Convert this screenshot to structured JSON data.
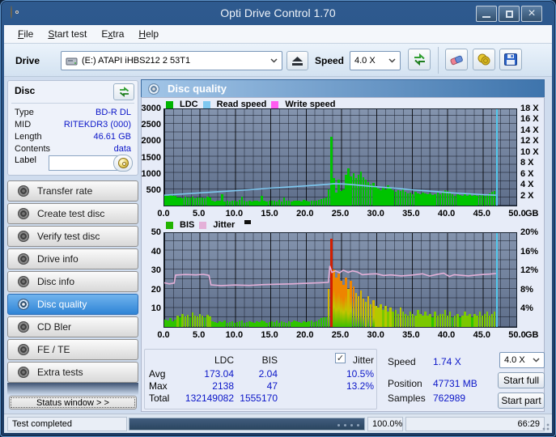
{
  "window": {
    "title": "Opti Drive Control 1.70"
  },
  "menu": {
    "items": [
      {
        "label": "File",
        "underline": 0
      },
      {
        "label": "Start test",
        "underline": 0
      },
      {
        "label": "Extra",
        "underline": 1
      },
      {
        "label": "Help",
        "underline": 0
      }
    ]
  },
  "toolbar": {
    "drive_label": "Drive",
    "drive_value": "(E:)   ATAPI iHBS212   2 53T1",
    "speed_label": "Speed",
    "speed_value": "4.0 X",
    "icons": [
      "drive-icon",
      "eject-icon",
      "refresh-icon",
      "eraser-icon",
      "coins-icon",
      "save-icon"
    ]
  },
  "disc_panel": {
    "title": "Disc",
    "rows": [
      {
        "label": "Type",
        "value": "BD-R DL"
      },
      {
        "label": "MID",
        "value": "RITEKDR3 (000)"
      },
      {
        "label": "Length",
        "value": "46.61 GB"
      },
      {
        "label": "Contents",
        "value": "data"
      }
    ],
    "label_row": {
      "label": "Label",
      "value": ""
    }
  },
  "sidebar": {
    "buttons": [
      {
        "label": "Transfer rate",
        "selected": false
      },
      {
        "label": "Create test disc",
        "selected": false
      },
      {
        "label": "Verify test disc",
        "selected": false
      },
      {
        "label": "Drive info",
        "selected": false
      },
      {
        "label": "Disc info",
        "selected": false
      },
      {
        "label": "Disc quality",
        "selected": true
      },
      {
        "label": "CD Bler",
        "selected": false
      },
      {
        "label": "FE / TE",
        "selected": false
      },
      {
        "label": "Extra tests",
        "selected": false
      }
    ],
    "status_window_label": "Status window > >"
  },
  "quality_header": "Disc quality",
  "chart_data": [
    {
      "type": "bar",
      "title": "Disc quality - LDC / speed",
      "legend": [
        {
          "label": "LDC",
          "color": "#00b400"
        },
        {
          "label": "Read speed",
          "color": "#7ec8f0"
        },
        {
          "label": "Write speed",
          "color": "#ff5cf0"
        }
      ],
      "x_axis": {
        "unit": "GB",
        "min": 0,
        "max": 50,
        "ticks": [
          "0.0",
          "5.0",
          "10.0",
          "15.0",
          "20.0",
          "25.0",
          "30.0",
          "35.0",
          "40.0",
          "45.0",
          "50.0"
        ]
      },
      "y_left": {
        "min": 0,
        "max": 3000,
        "tick_values": [
          3000,
          2500,
          2000,
          1500,
          1000,
          500
        ],
        "tick_labels": [
          "3000",
          "2500",
          "2000",
          "1500",
          "1000",
          "500"
        ]
      },
      "y_right": {
        "min": 0,
        "max": 18,
        "tick_values": [
          18,
          16,
          14,
          12,
          10,
          8,
          6,
          4,
          2
        ],
        "tick_labels": [
          "18 X",
          "16 X",
          "14 X",
          "12 X",
          "10 X",
          "8 X",
          "6 X",
          "4 X",
          "2 X"
        ]
      },
      "end_marker_x": 46.9,
      "series": [
        {
          "name": "LDC",
          "kind": "bar",
          "axis": "left",
          "x_step": 0.35,
          "color": "#00c400",
          "values": [
            320,
            290,
            340,
            300,
            310,
            240,
            260,
            230,
            270,
            250,
            240,
            280,
            230,
            260,
            240,
            250,
            230,
            270,
            240,
            150,
            130,
            160,
            140,
            340,
            130,
            150,
            120,
            160,
            140,
            130,
            170,
            280,
            140,
            120,
            150,
            130,
            160,
            140,
            120,
            300,
            150,
            130,
            160,
            140,
            150,
            120,
            170,
            130,
            250,
            140,
            160,
            130,
            150,
            140,
            160,
            120,
            180,
            140,
            130,
            160,
            150,
            140,
            170,
            200,
            220,
            260,
            500,
            2100,
            850,
            400,
            800,
            450,
            500,
            950,
            1150,
            900,
            1000,
            850,
            950,
            1050,
            880,
            800,
            720,
            650,
            700,
            600,
            520,
            480,
            560,
            500,
            620,
            540,
            460,
            430,
            480,
            440,
            500,
            420,
            380,
            400,
            360,
            420,
            380,
            350,
            400,
            370,
            340,
            380,
            330,
            360,
            400,
            350,
            420,
            480,
            440,
            400,
            340,
            310,
            360,
            330,
            300,
            340,
            310,
            350,
            300,
            330,
            290,
            320,
            350,
            310,
            340,
            380,
            420,
            450
          ]
        },
        {
          "name": "Read speed",
          "kind": "line",
          "axis": "right",
          "color": "#7ec8f0",
          "points": [
            [
              0,
              2.2
            ],
            [
              3,
              2.45
            ],
            [
              6,
              2.7
            ],
            [
              9,
              2.95
            ],
            [
              12,
              3.2
            ],
            [
              15,
              3.5
            ],
            [
              18,
              3.75
            ],
            [
              21,
              4.0
            ],
            [
              23,
              4.2
            ],
            [
              24,
              4.3
            ],
            [
              25.5,
              4.25
            ],
            [
              27,
              4.1
            ],
            [
              29,
              3.85
            ],
            [
              31,
              3.65
            ],
            [
              33,
              3.45
            ],
            [
              35,
              3.2
            ],
            [
              37,
              3.0
            ],
            [
              39,
              2.8
            ],
            [
              41,
              2.6
            ],
            [
              43,
              2.45
            ],
            [
              45,
              2.3
            ],
            [
              46.9,
              2.2
            ]
          ]
        }
      ]
    },
    {
      "type": "bar",
      "title": "Disc quality - BIS / Jitter",
      "legend": [
        {
          "label": "BIS",
          "color": "#22b400"
        },
        {
          "label": "Jitter",
          "color": "#e4b0d8"
        }
      ],
      "x_axis": {
        "unit": "GB",
        "min": 0,
        "max": 50,
        "ticks": [
          "0.0",
          "5.0",
          "10.0",
          "15.0",
          "20.0",
          "25.0",
          "30.0",
          "35.0",
          "40.0",
          "45.0",
          "50.0"
        ]
      },
      "y_left": {
        "min": 0,
        "max": 50,
        "tick_values": [
          50,
          40,
          30,
          20,
          10
        ],
        "tick_labels": [
          "50",
          "40",
          "30",
          "20",
          "10"
        ]
      },
      "y_right": {
        "min": 0,
        "max": 20,
        "tick_values": [
          20,
          16,
          12,
          8,
          4
        ],
        "tick_labels": [
          "20%",
          "16%",
          "12%",
          "8%",
          "4%"
        ]
      },
      "end_marker_x": 46.9,
      "color_scale": [
        {
          "max": 5,
          "color": "#2ec400"
        },
        {
          "max": 9,
          "color": "#7bc800"
        },
        {
          "max": 13,
          "color": "#b4c800"
        },
        {
          "max": 20,
          "color": "#d8b400"
        },
        {
          "max": 34,
          "color": "#ee8400"
        },
        {
          "max": 100,
          "color": "#d41e00"
        }
      ],
      "series": [
        {
          "name": "BIS",
          "kind": "bar",
          "axis": "left",
          "x_step": 0.35,
          "values": [
            4,
            3.5,
            4.5,
            3,
            4,
            6,
            5,
            7,
            5.5,
            6.5,
            5,
            7.5,
            6,
            5.5,
            7,
            6,
            5,
            6.5,
            5.5,
            3,
            2.5,
            2,
            3,
            2.5,
            3.5,
            2,
            2.5,
            3,
            2,
            2.5,
            3,
            3.5,
            2,
            2.5,
            3,
            2.5,
            2,
            3,
            2.5,
            3.5,
            3,
            2,
            2.5,
            3,
            2.5,
            3.5,
            2,
            3,
            2.5,
            2,
            3,
            2.5,
            3.5,
            3,
            2.5,
            2,
            3,
            2.5,
            3,
            3.5,
            2.5,
            3,
            4,
            4.5,
            5,
            5,
            20,
            46,
            30,
            26,
            28,
            24,
            22,
            26,
            20,
            24,
            21,
            18,
            16,
            19,
            15,
            13,
            16,
            12,
            14,
            11,
            10,
            12,
            9,
            11,
            8,
            10,
            8,
            9,
            7,
            10,
            8,
            7,
            6,
            8,
            7,
            6,
            9,
            7,
            6,
            8,
            6,
            7,
            5,
            8,
            6,
            7,
            7,
            9,
            6,
            8,
            5,
            6,
            7,
            5,
            6,
            8,
            6,
            7,
            5,
            7,
            6,
            8,
            6,
            7,
            8,
            6,
            7,
            8
          ]
        },
        {
          "name": "Jitter",
          "kind": "line",
          "axis": "left",
          "color": "#e4b0d8",
          "points": [
            [
              0,
              24
            ],
            [
              0.7,
              23.4
            ],
            [
              1.4,
              23.8
            ],
            [
              1.6,
              28
            ],
            [
              3,
              28.3
            ],
            [
              4.5,
              28.1
            ],
            [
              5.5,
              28.4
            ],
            [
              6.3,
              27.9
            ],
            [
              6.6,
              22.9
            ],
            [
              8,
              22.5
            ],
            [
              10,
              22.8
            ],
            [
              12,
              22.6
            ],
            [
              14,
              23
            ],
            [
              16,
              23.2
            ],
            [
              18,
              23.4
            ],
            [
              20,
              23.7
            ],
            [
              22,
              24
            ],
            [
              23.2,
              24.2
            ],
            [
              23.4,
              32.8
            ],
            [
              23.7,
              29.4
            ],
            [
              24.2,
              30.2
            ],
            [
              24.8,
              29.2
            ],
            [
              25.3,
              30.6
            ],
            [
              26,
              29.4
            ],
            [
              26.6,
              30.2
            ],
            [
              27.3,
              29.6
            ],
            [
              28,
              28.2
            ],
            [
              29,
              28.5
            ],
            [
              30,
              28.7
            ],
            [
              31,
              27.8
            ],
            [
              32,
              28.1
            ],
            [
              33.5,
              27.6
            ],
            [
              35,
              28
            ],
            [
              36.5,
              28.7
            ],
            [
              37.5,
              27.5
            ],
            [
              38.5,
              28.3
            ],
            [
              39.5,
              29
            ],
            [
              40.3,
              27.3
            ],
            [
              41,
              28.2
            ],
            [
              42,
              27.9
            ],
            [
              43,
              27.6
            ],
            [
              44,
              28
            ],
            [
              45,
              28.3
            ],
            [
              46,
              28.5
            ],
            [
              46.9,
              28.8
            ]
          ]
        }
      ]
    }
  ],
  "stats": {
    "columns": {
      "ldc": "LDC",
      "bis": "BIS",
      "jitter": "Jitter"
    },
    "jitter_checked": true,
    "rows": [
      {
        "label": "Avg",
        "ldc": "173.04",
        "bis": "2.04",
        "jitter": "10.5%"
      },
      {
        "label": "Max",
        "ldc": "2138",
        "bis": "47",
        "jitter": "13.2%"
      },
      {
        "label": "Total",
        "ldc": "132149082",
        "bis": "1555170",
        "jitter": ""
      }
    ]
  },
  "controls": {
    "speed_label": "Speed",
    "speed_value": "1.74 X",
    "speed_select": "4.0 X",
    "position_label": "Position",
    "position_value": "47731 MB",
    "samples_label": "Samples",
    "samples_value": "762989",
    "start_full_label": "Start full",
    "start_part_label": "Start part"
  },
  "statusbar": {
    "status": "Test completed",
    "progress_percent": "100.0%",
    "time": "66:29"
  },
  "colors": {
    "accent_selected": "#2f84d6",
    "value_text": "#0b16c8",
    "end_marker": "#52c8ec",
    "chart_bg_top": "#8494ae",
    "chart_bg_bottom": "#5e6e8a"
  }
}
